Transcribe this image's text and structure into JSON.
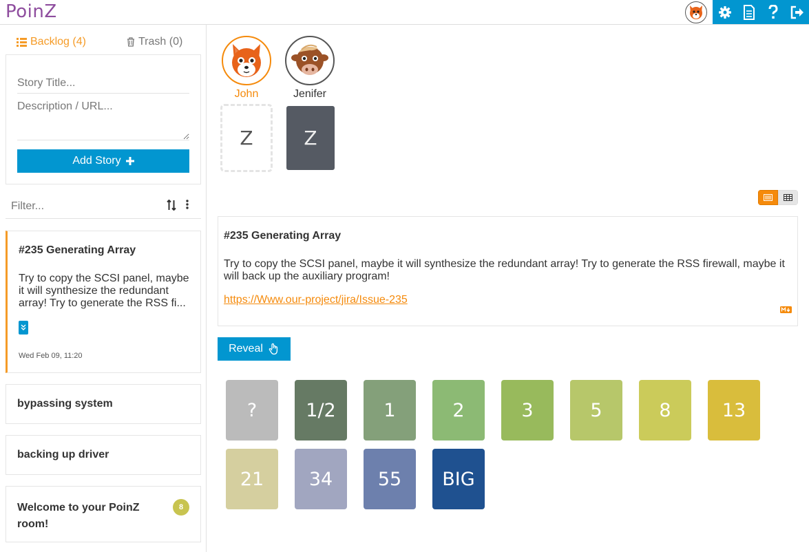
{
  "app": {
    "logo": "PoinZ"
  },
  "sidebar": {
    "backlog_tab": "Backlog (4)",
    "trash_tab": "Trash (0)",
    "form": {
      "title_placeholder": "Story Title...",
      "description_placeholder": "Description / URL...",
      "add_button": "Add Story"
    },
    "filter_placeholder": "Filter...",
    "stories": [
      {
        "title": "#235 Generating Array",
        "description": "Try to copy the SCSI panel, maybe it will synthesize the redundant array! Try to generate the RSS fi...",
        "date": "Wed Feb 09, 11:20"
      },
      {
        "title": "bypassing system"
      },
      {
        "title": "backing up driver"
      },
      {
        "title": "Welcome to your PoinZ room!",
        "badge": "8"
      }
    ]
  },
  "main": {
    "users": [
      {
        "name": "John",
        "card": "Z",
        "avatar": "fox",
        "color": "#f58a0b"
      },
      {
        "name": "Jenifer",
        "card": "Z",
        "avatar": "cow",
        "color": "#333333"
      }
    ],
    "story": {
      "title": "#235 Generating Array",
      "description": "Try to copy the SCSI panel, maybe it will synthesize the redundant array! Try to generate the RSS firewall, maybe it will back up the auxiliary program!",
      "link": "https://Www.our-project/jira/Issue-235"
    },
    "reveal_button": "Reveal",
    "cards": [
      {
        "label": "?",
        "color": "#bbbbbb"
      },
      {
        "label": "1/2",
        "color": "#667a64"
      },
      {
        "label": "1",
        "color": "#84a07a"
      },
      {
        "label": "2",
        "color": "#8cba74"
      },
      {
        "label": "3",
        "color": "#98ba5c"
      },
      {
        "label": "5",
        "color": "#b7c76a"
      },
      {
        "label": "8",
        "color": "#cbcb5a"
      },
      {
        "label": "13",
        "color": "#d9bd3c"
      },
      {
        "label": "21",
        "color": "#d5cf9f"
      },
      {
        "label": "34",
        "color": "#a1a6c0"
      },
      {
        "label": "55",
        "color": "#6d80ad"
      },
      {
        "label": "BIG",
        "color": "#1f5190"
      }
    ]
  },
  "colors": {
    "accent": "#f58a0b",
    "primary": "#0296d0",
    "brand": "#8e4d9e"
  }
}
